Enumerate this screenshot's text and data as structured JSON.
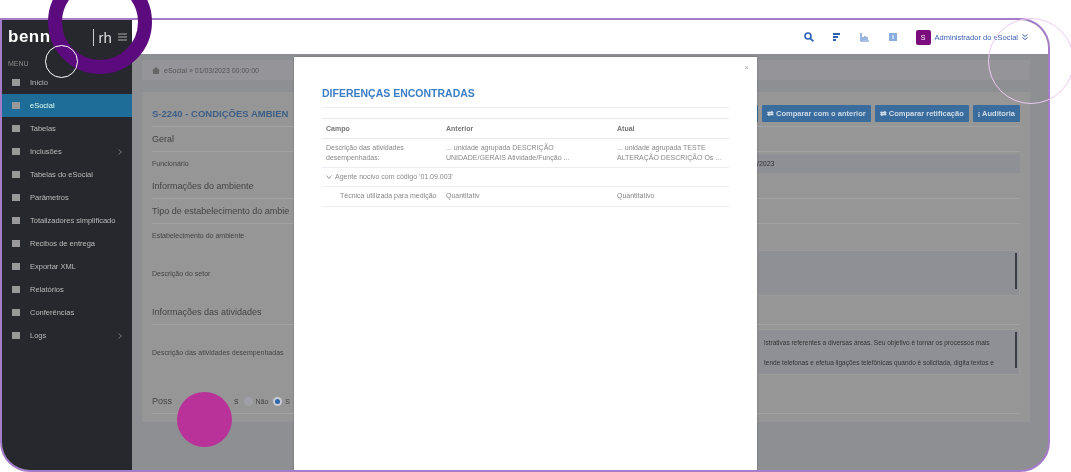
{
  "logo": {
    "text": "benn",
    "suffix": "rh"
  },
  "sidebar": {
    "heading": "MENU",
    "items": [
      {
        "label": "Início",
        "selected": false,
        "submenu": false
      },
      {
        "label": "eSocial",
        "selected": true,
        "submenu": false
      },
      {
        "label": "Tabelas",
        "selected": false,
        "submenu": false
      },
      {
        "label": "Inclusões",
        "selected": false,
        "submenu": true
      },
      {
        "label": "Tabelas do eSocial",
        "selected": false,
        "submenu": false
      },
      {
        "label": "Parâmetros",
        "selected": false,
        "submenu": false
      },
      {
        "label": "Totalizadores simplificado",
        "selected": false,
        "submenu": false
      },
      {
        "label": "Recibos de entrega",
        "selected": false,
        "submenu": false
      },
      {
        "label": "Exportar XML",
        "selected": false,
        "submenu": false
      },
      {
        "label": "Relatórios",
        "selected": false,
        "submenu": false
      },
      {
        "label": "Conferências",
        "selected": false,
        "submenu": false
      },
      {
        "label": "Logs",
        "selected": false,
        "submenu": true
      }
    ]
  },
  "topbar": {
    "avatar": "S",
    "user": "Administrador do eSocial"
  },
  "breadcrumb": "eSocial » 01/03/2023 00:00:00",
  "page": {
    "title": "S-2240 - CONDIÇÕES AMBIEN",
    "buttons": [
      {
        "label": "⇄ Comparar com o anterior"
      },
      {
        "label": "⇄ Comparar retificação"
      },
      {
        "label": "¡ Auditoria"
      }
    ],
    "rows": [
      {
        "kind": "heading",
        "label": "Geral"
      },
      {
        "kind": "field",
        "label": "Funcionário",
        "value": "/2023"
      },
      {
        "kind": "heading",
        "label": "Informações do ambiente"
      },
      {
        "kind": "heading",
        "label": "Tipo de estabelecimento do ambie"
      },
      {
        "kind": "field",
        "label": "Estabelecimento do ambiente"
      },
      {
        "kind": "textarea",
        "label": "Descrição do setor",
        "lines": []
      },
      {
        "kind": "heading",
        "label": "Informações das atividades"
      },
      {
        "kind": "textarea",
        "label": "Descrição das atividades desempenhadas",
        "lines": [
          "istrativas referentes a diversas áreas. Seu objetivo é tornar os processos mais",
          "tende telefonas e efetua ligações telefônicas quando é solicitada,  digita textos e"
        ]
      },
      {
        "kind": "radio",
        "label": "Poss",
        "label_end": "s",
        "options": [
          {
            "label": "Não",
            "selected": false
          },
          {
            "label": "S",
            "selected": true
          }
        ]
      }
    ]
  },
  "modal": {
    "close": "×",
    "title": "DIFERENÇAS ENCONTRADAS",
    "columns": [
      "Campo",
      "Anterior",
      "Atual"
    ],
    "rows": [
      {
        "kind": "field",
        "campo": "Descrição das atividades desempenhadas:",
        "anterior": "... unidade agrupada DESCRIÇÃO UNIDADE/GERAIS Atividade/Função ...",
        "atual": "... unidade agrupada TESTE ALTERAÇÃO DESCRIÇÃO Os ..."
      },
      {
        "kind": "group",
        "label": "Agente nocivo com código '01.09.003'",
        "expanded": true,
        "children": [
          {
            "kind": "field",
            "campo": "Técnica utilizada para medição",
            "anterior": "Quantitativ",
            "atual": "Quantitativo"
          }
        ]
      }
    ]
  }
}
